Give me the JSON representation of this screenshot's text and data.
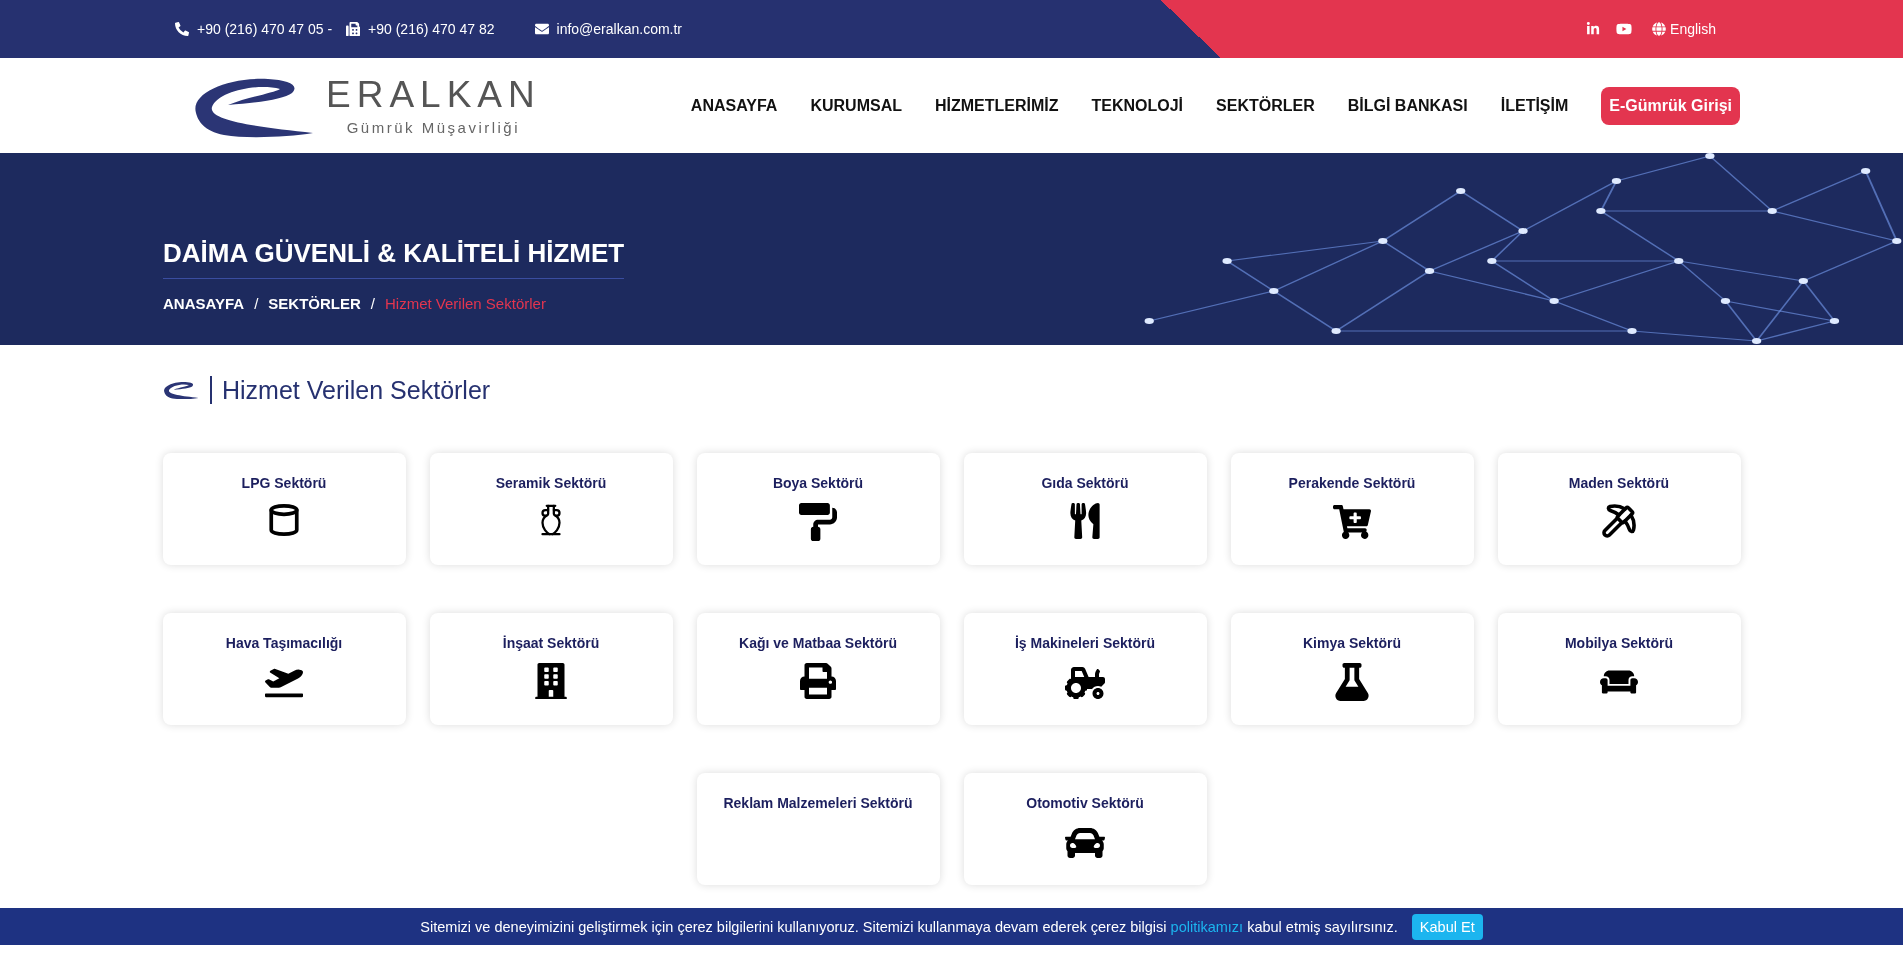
{
  "top_bar": {
    "phone": "+90 (216) 470 47 05 -",
    "fax": "+90 (216) 470 47 82",
    "email": "info@eralkan.com.tr",
    "language": "English"
  },
  "header": {
    "logo_name": "ERALKAN",
    "logo_subtitle": "Gümrük Müşavirliği",
    "nav": [
      {
        "label": "ANASAYFA",
        "kind": "link"
      },
      {
        "label": "KURUMSAL",
        "kind": "link"
      },
      {
        "label": "HİZMETLERİMİZ",
        "kind": "link"
      },
      {
        "label": "TEKNOLOJİ",
        "kind": "link"
      },
      {
        "label": "SEKTÖRLER",
        "kind": "link"
      },
      {
        "label": "BİLGİ BANKASI",
        "kind": "link"
      },
      {
        "label": "İLETİŞİM",
        "kind": "link"
      },
      {
        "label": "E-Gümrük Girişi",
        "kind": "button"
      }
    ]
  },
  "hero": {
    "title": "DAİMA GÜVENLİ & KALİTELİ HİZMET",
    "separator": "/",
    "breadcrumb": [
      {
        "label": "ANASAYFA",
        "selected": false
      },
      {
        "label": "SEKTÖRLER",
        "selected": false
      },
      {
        "label": "Hizmet Verilen Sektörler",
        "selected": true
      }
    ]
  },
  "section": {
    "title": "Hizmet Verilen Sektörler",
    "sectors": [
      {
        "title": "LPG Sektörü"
      },
      {
        "title": "Seramik Sektörü"
      },
      {
        "title": "Boya Sektörü"
      },
      {
        "title": "Gıda Sektörü"
      },
      {
        "title": "Perakende Sektörü"
      },
      {
        "title": "Maden Sektörü"
      },
      {
        "title": "Hava Taşımacılığı"
      },
      {
        "title": "İnşaat Sektörü"
      },
      {
        "title": "Kağı ve Matbaa Sektörü"
      },
      {
        "title": "İş Makineleri Sektörü"
      },
      {
        "title": "Kimya Sektörü"
      },
      {
        "title": "Mobilya Sektörü"
      },
      {
        "title": "Reklam Malzemeleri Sektörü"
      },
      {
        "title": "Otomotiv Sektörü"
      }
    ]
  },
  "cookie_bar": {
    "text_before": "Sitemizi ve deneyimizini geliştirmek için çerez bilgilerini kullanıyoruz. Sitemizi kullanmaya devam ederek çerez bilgisi",
    "link": "politikamızı",
    "text_after": "kabul etmiş sayılırsınız.",
    "button": "Kabul Et"
  }
}
